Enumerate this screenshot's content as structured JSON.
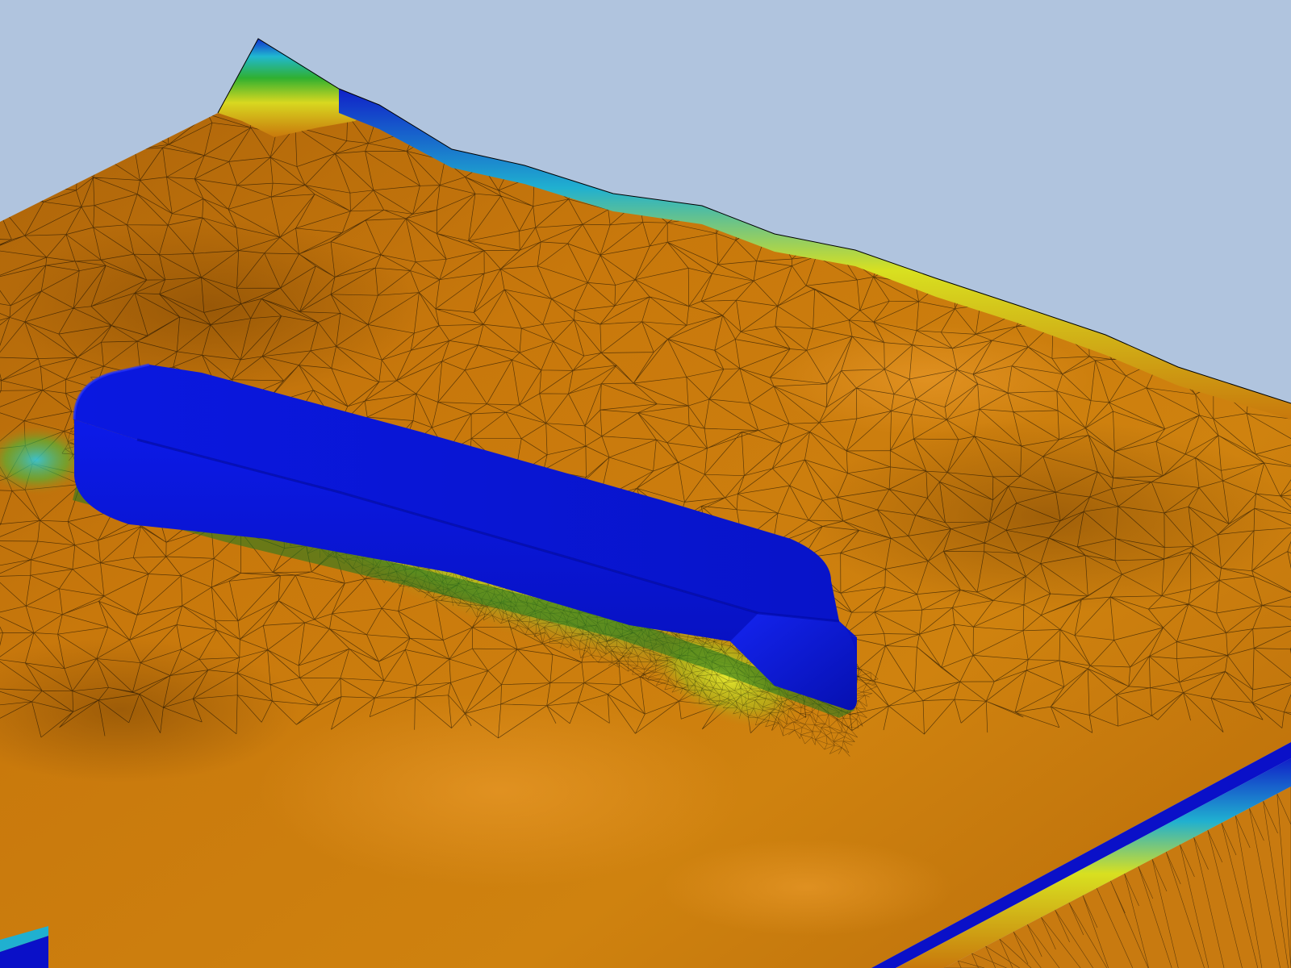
{
  "viewport": {
    "background_color": "#b0c4de",
    "render_mode": "shaded-with-mesh-edges"
  },
  "colors": {
    "terrain": "#c8780c",
    "terrain_light": "#e89a1e",
    "terrain_dark": "#8a4e06",
    "mesh_edge": "#000000",
    "contour_yellow": "#e8e820",
    "contour_green": "#2eb82e",
    "contour_cyan": "#20c0d8",
    "hull": "#0a14d8",
    "hull_dark": "#00008a",
    "boundary_blue": "#0a10c8"
  },
  "scene_objects": [
    {
      "name": "ocean-floor-mesh",
      "icon": "mesh-surface"
    },
    {
      "name": "ship-hull",
      "icon": "hull-solid"
    },
    {
      "name": "domain-boundary",
      "icon": "boundary-wall"
    }
  ]
}
